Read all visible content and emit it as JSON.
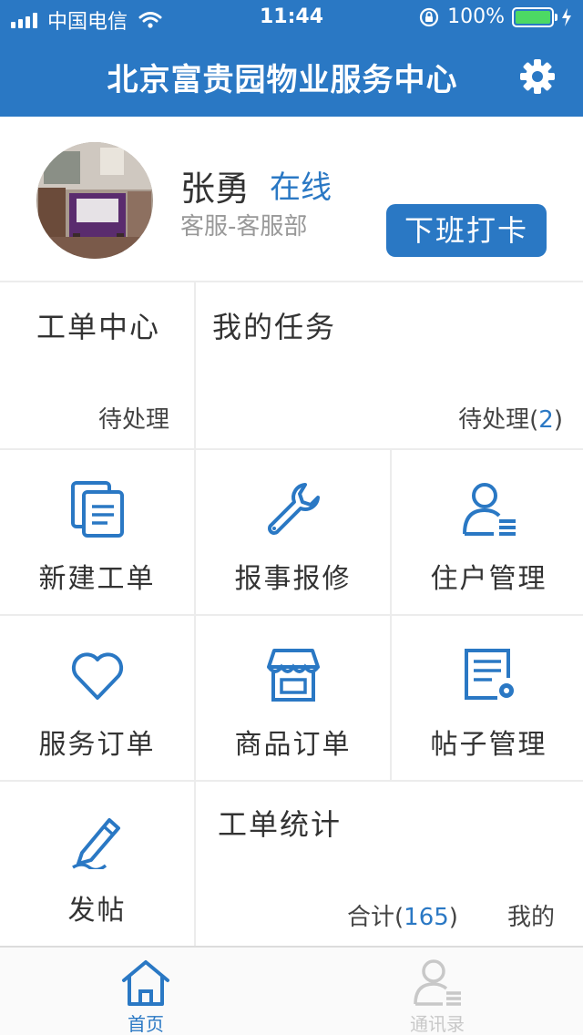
{
  "status_bar": {
    "carrier": "中国电信",
    "time": "11:44",
    "battery": "100%"
  },
  "nav": {
    "title": "北京富贵园物业服务中心",
    "settings_icon": "gear-icon"
  },
  "profile": {
    "name": "张勇",
    "status": "在线",
    "department": "客服-客服部",
    "clock_button": "下班打卡"
  },
  "work_order_center": {
    "title": "工单中心",
    "pending_label": "待处理"
  },
  "my_tasks": {
    "title": "我的任务",
    "pending_label": "待处理(",
    "pending_count": "2",
    "pending_close": ")"
  },
  "grid": [
    {
      "label": "新建工单",
      "icon": "document-icon"
    },
    {
      "label": "报事报修",
      "icon": "wrench-icon"
    },
    {
      "label": "住户管理",
      "icon": "user-list-icon"
    },
    {
      "label": "服务订单",
      "icon": "heart-icon"
    },
    {
      "label": "商品订单",
      "icon": "store-icon"
    },
    {
      "label": "帖子管理",
      "icon": "post-settings-icon"
    },
    {
      "label": "发帖",
      "icon": "pencil-icon"
    }
  ],
  "stats": {
    "title": "工单统计",
    "total_label": "合计(",
    "total_count": "165",
    "total_close": ")",
    "mine_label": "我的"
  },
  "tabbar": [
    {
      "label": "首页",
      "icon": "home-icon",
      "active": true
    },
    {
      "label": "通讯录",
      "icon": "contacts-icon",
      "active": false
    }
  ],
  "colors": {
    "primary": "#2a78c4",
    "battery": "#4cd964",
    "inactive_tab": "#c8c8c8"
  }
}
